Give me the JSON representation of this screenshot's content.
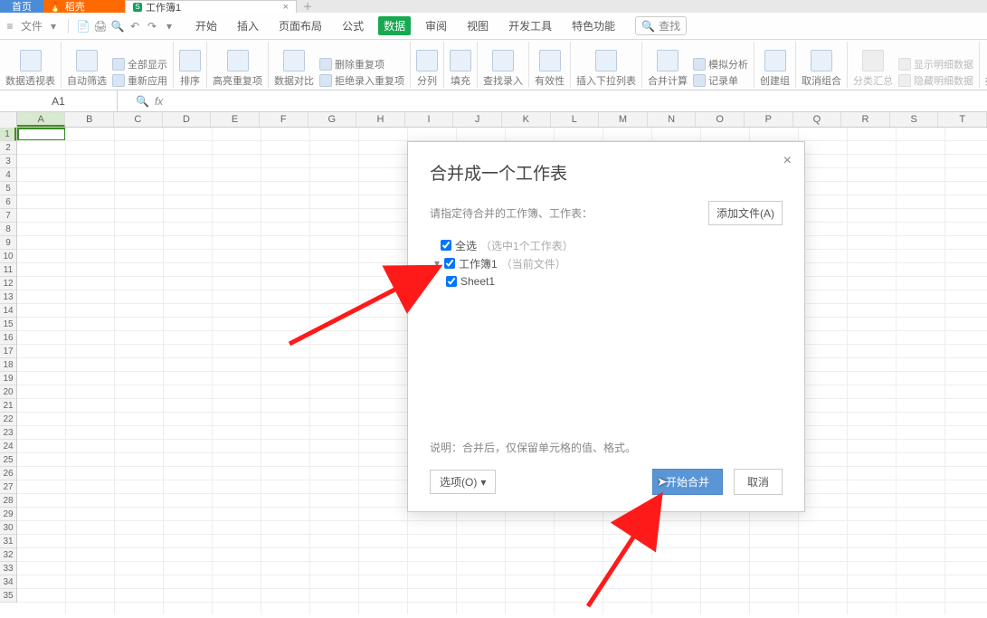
{
  "tabs": {
    "home": "首页",
    "dk": "稻壳",
    "wb_icon": "S",
    "wb_label": "工作簿1",
    "close": "×",
    "plus": "＋"
  },
  "qa": {
    "menu": "≡",
    "file": "文件",
    "file_arrow": "▾",
    "save": "📄",
    "print": "🖨",
    "preview": "🔍",
    "undo": "↶",
    "redo": "↷",
    "dropdown": "▾"
  },
  "menu": {
    "items": [
      "开始",
      "插入",
      "页面布局",
      "公式",
      "数据",
      "审阅",
      "视图",
      "开发工具",
      "特色功能"
    ],
    "active_index": 4,
    "find_icon": "🔍",
    "find_label": "查找"
  },
  "ribbon": {
    "g1": "数据透视表",
    "g2": "自动筛选",
    "g2a": "全部显示",
    "g2b": "重新应用",
    "g3": "排序",
    "g4": "高亮重复项",
    "g5": "数据对比",
    "g5a": "删除重复项",
    "g5b": "拒绝录入重复项",
    "g6": "分列",
    "g7": "填充",
    "g8": "查找录入",
    "g9": "有效性",
    "g10": "插入下拉列表",
    "g11": "合并计算",
    "g11a": "模拟分析",
    "g11b": "记录单",
    "g12": "创建组",
    "g13": "取消组合",
    "g14": "分类汇总",
    "g14a": "显示明细数据",
    "g14b": "隐藏明细数据",
    "g15": "拆分表格"
  },
  "namebox": "A1",
  "fx": {
    "zoom": "🔍",
    "fx": "fx"
  },
  "cols": [
    "A",
    "B",
    "C",
    "D",
    "E",
    "F",
    "G",
    "H",
    "I",
    "J",
    "K",
    "L",
    "M",
    "N",
    "O",
    "P",
    "Q",
    "R",
    "S",
    "T"
  ],
  "dialog": {
    "title": "合并成一个工作表",
    "subtitle": "请指定待合并的工作簿、工作表：",
    "add_file": "添加文件(A)",
    "select_all": "全选",
    "select_hint": "（选中1个工作表）",
    "wb_name": "工作簿1",
    "wb_hint": "（当前文件）",
    "sheet1": "Sheet1",
    "note": "说明：合并后，仅保留单元格的值、格式。",
    "options": "选项(O)",
    "start": "开始合并",
    "cancel": "取消",
    "close": "×",
    "tw": "▾"
  }
}
